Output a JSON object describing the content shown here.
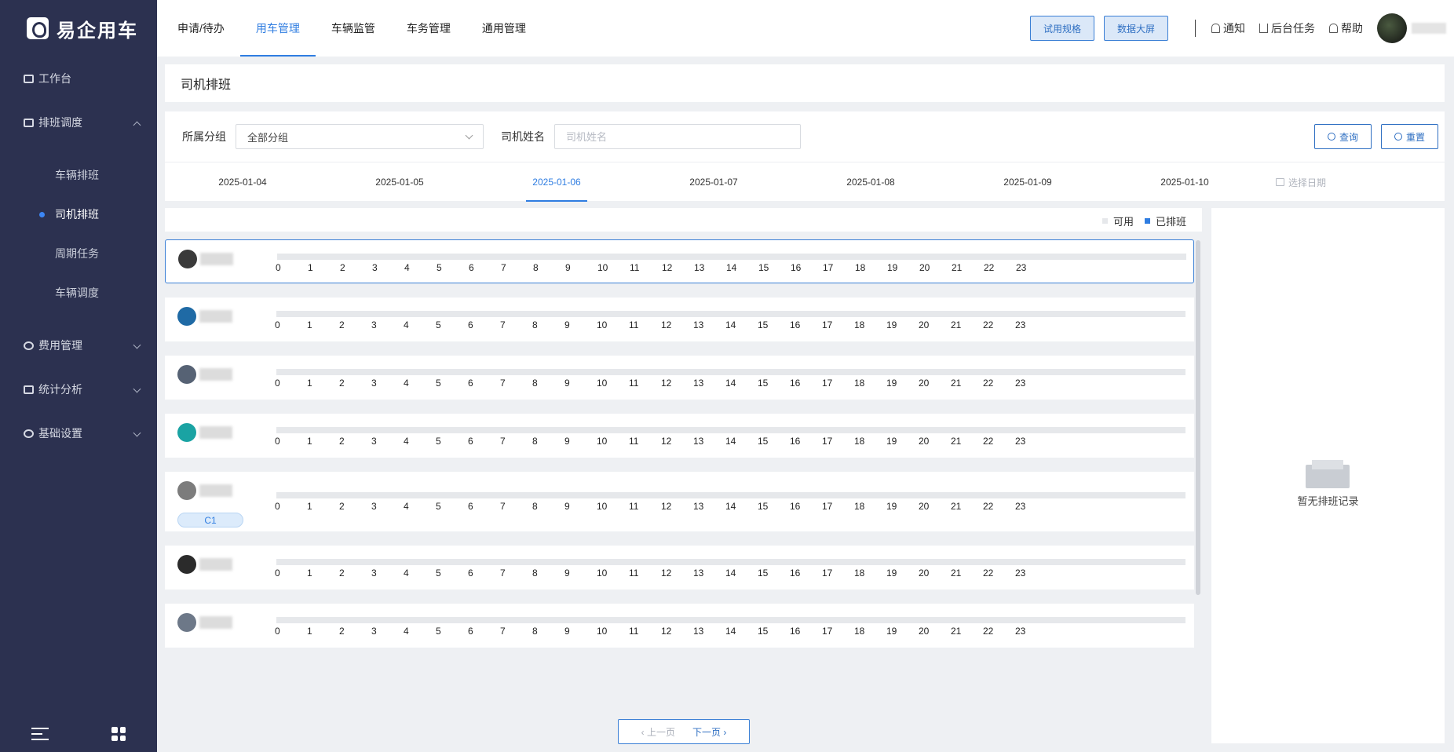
{
  "app": {
    "logo_text": "易企用车"
  },
  "sidebar": {
    "items": [
      {
        "label": "工作台",
        "icon": "dashboard-icon"
      },
      {
        "label": "排班调度",
        "icon": "calendar-icon",
        "expanded": true,
        "children": [
          {
            "label": "车辆排班",
            "active": false
          },
          {
            "label": "司机排班",
            "active": true
          },
          {
            "label": "周期任务",
            "active": false
          },
          {
            "label": "车辆调度",
            "active": false
          }
        ]
      },
      {
        "label": "费用管理",
        "icon": "money-bag-icon"
      },
      {
        "label": "统计分析",
        "icon": "bar-chart-icon"
      },
      {
        "label": "基础设置",
        "icon": "gear-icon"
      }
    ]
  },
  "topbar": {
    "tabs": [
      "申请/待办",
      "用车管理",
      "车辆监管",
      "车务管理",
      "通用管理"
    ],
    "active_tab": "用车管理",
    "trial_button": "试用规格",
    "screen_button": "数据大屏",
    "notify": "通知",
    "tasks": "后台任务",
    "help": "帮助"
  },
  "page": {
    "title": "司机排班"
  },
  "filter": {
    "group_label": "所属分组",
    "group_value": "全部分组",
    "name_label": "司机姓名",
    "name_placeholder": "司机姓名",
    "query_button": "查询",
    "reset_button": "重置"
  },
  "dates": {
    "tabs": [
      "2025-01-04",
      "2025-01-05",
      "2025-01-06",
      "2025-01-07",
      "2025-01-08",
      "2025-01-09",
      "2025-01-10"
    ],
    "active": "2025-01-06",
    "picker_placeholder": "选择日期"
  },
  "legend": {
    "available": "可用",
    "scheduled": "已排班",
    "available_color": "#e6e8eb",
    "scheduled_color": "#2f7de1"
  },
  "hours": [
    "0",
    "1",
    "2",
    "3",
    "4",
    "5",
    "6",
    "7",
    "8",
    "9",
    "10",
    "11",
    "12",
    "13",
    "14",
    "15",
    "16",
    "17",
    "18",
    "19",
    "20",
    "21",
    "22",
    "23"
  ],
  "drivers": [
    {
      "badge": "",
      "selected": true
    },
    {
      "badge": "",
      "selected": false
    },
    {
      "badge": "",
      "selected": false
    },
    {
      "badge": "",
      "selected": false
    },
    {
      "badge": "C1",
      "selected": false
    },
    {
      "badge": "",
      "selected": false
    },
    {
      "badge": "",
      "selected": false
    }
  ],
  "pager": {
    "prev": "上一页",
    "next": "下一页"
  },
  "detail": {
    "empty_text": "暂无排班记录"
  }
}
